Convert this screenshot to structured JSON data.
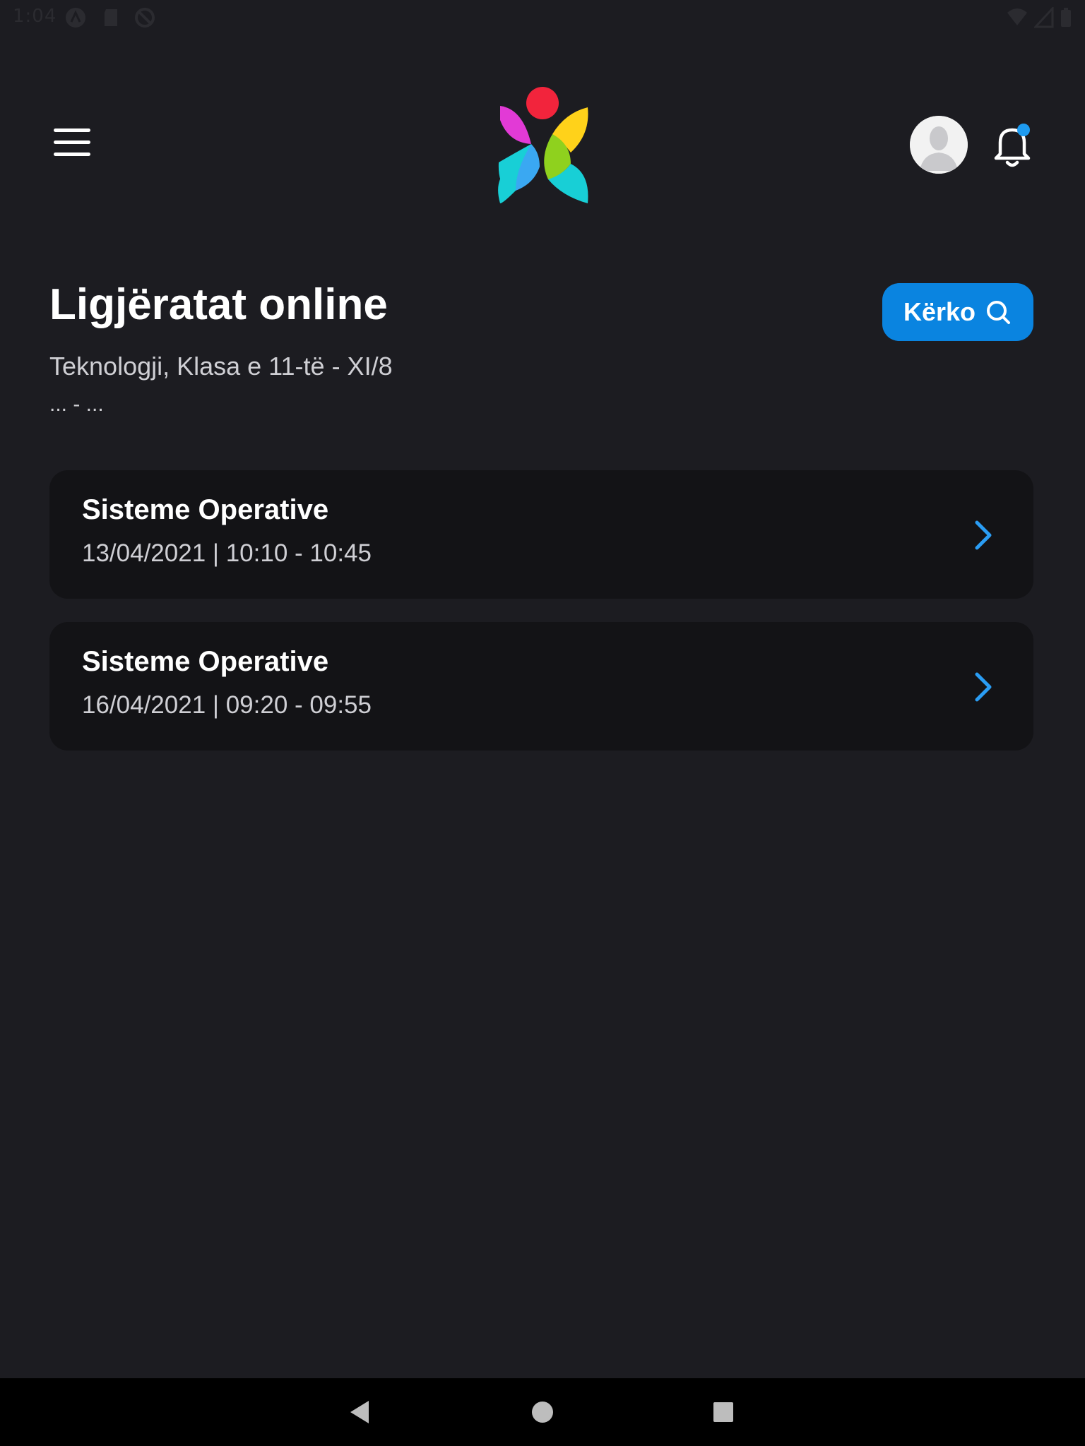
{
  "status_bar": {
    "time": "1:04",
    "icons": [
      "a-icon",
      "sd-card-icon",
      "sync-icon",
      "wifi-icon",
      "signal-icon",
      "battery-icon"
    ]
  },
  "header": {
    "menu_icon": "hamburger-menu-icon",
    "logo": "app-logo",
    "avatar": "user-avatar",
    "notification_icon": "bell-icon",
    "notification_dot_color": "#1e9bf0"
  },
  "page": {
    "title": "Ligjëratat online",
    "subtitle": "Teknologji, Klasa e 11-të - XI/8",
    "range": "... - ...",
    "search_label": "Kërko"
  },
  "lessons": [
    {
      "title": "Sisteme Operative",
      "time": "13/04/2021 | 10:10 - 10:45"
    },
    {
      "title": "Sisteme Operative",
      "time": "16/04/2021 | 09:20 - 09:55"
    }
  ],
  "colors": {
    "background": "#1c1c21",
    "card": "#131316",
    "accent": "#0a84e0",
    "chevron": "#2a9df4"
  },
  "nav": [
    "back-icon",
    "home-icon",
    "recents-icon"
  ]
}
